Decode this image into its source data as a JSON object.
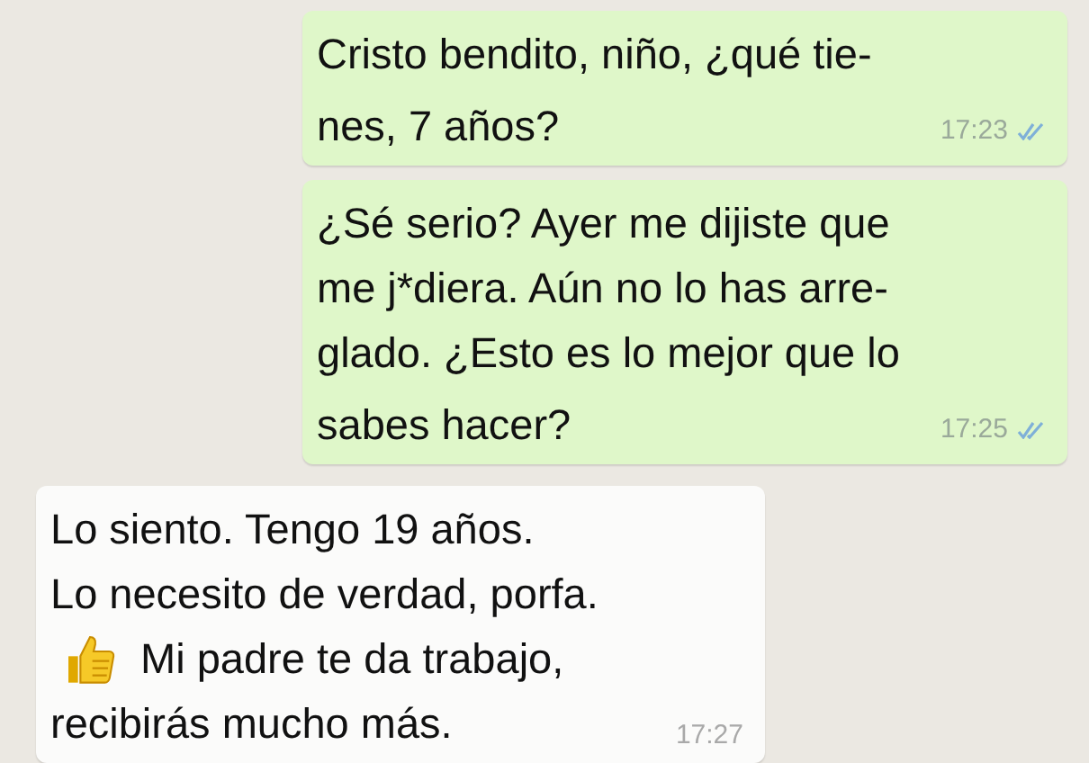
{
  "messages": [
    {
      "kind": "outgoing",
      "lines": [
        {
          "text": "Cristo bendito, niño, ¿qué tie-"
        },
        {
          "text": "nes, 7 años?"
        }
      ],
      "time": "17:23",
      "read": true
    },
    {
      "kind": "outgoing",
      "lines": [
        {
          "text": "¿Sé serio? Ayer me dijiste que"
        },
        {
          "text": "me j*diera. Aún no lo has arre-"
        },
        {
          "text": "glado. ¿Esto es lo mejor que lo"
        },
        {
          "text": "sabes hacer?"
        }
      ],
      "time": "17:25",
      "read": true
    },
    {
      "kind": "incoming",
      "lines": [
        {
          "text": "Lo siento. Tengo 19 años."
        },
        {
          "text": "Lo necesito de verdad, porfa."
        },
        {
          "kind": "emoji",
          "text": "Mi padre te da trabajo,"
        },
        {
          "text": "recibirás mucho más."
        }
      ],
      "time": "17:27"
    }
  ]
}
